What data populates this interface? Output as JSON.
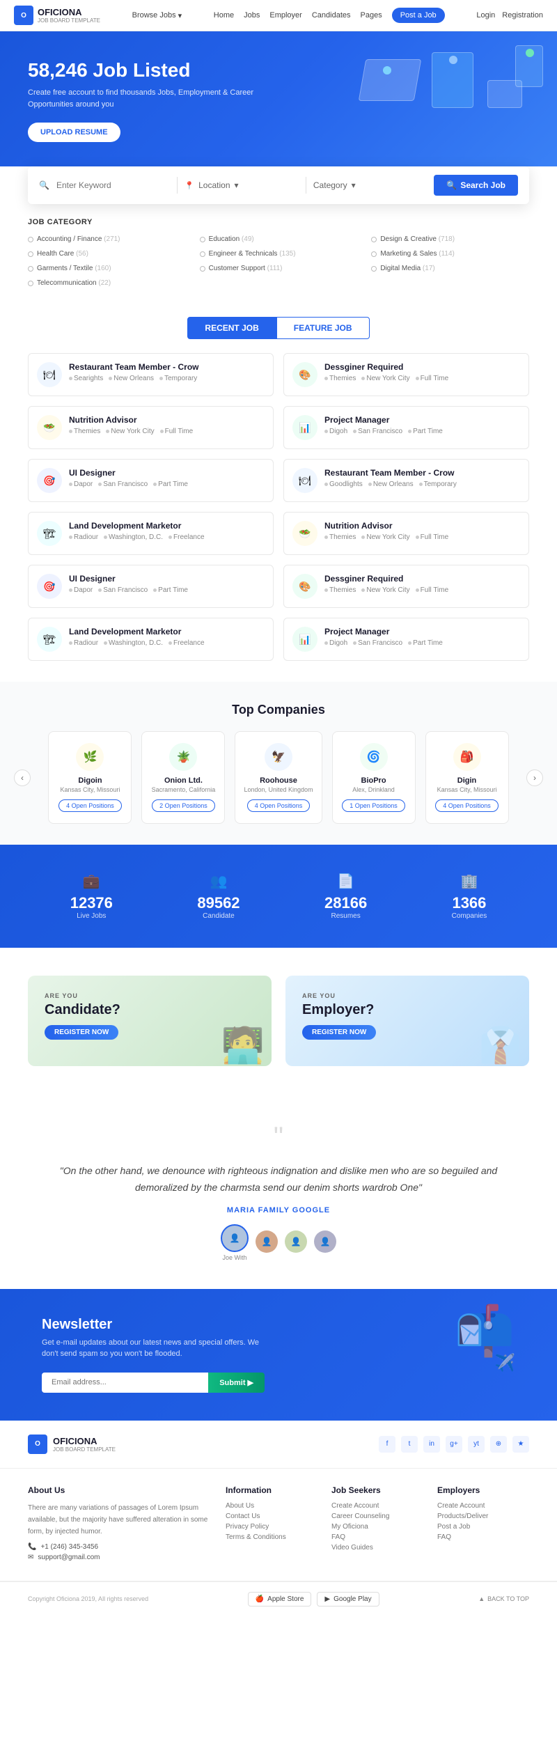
{
  "brand": {
    "name": "OFICIONA",
    "tagline": "JOB BOARD TEMPLATE",
    "logo_letter": "O"
  },
  "navbar": {
    "browse_label": "Browse Jobs",
    "links": [
      "Home",
      "Jobs",
      "Employer",
      "Candidates",
      "Pages"
    ],
    "post_job_label": "Post a Job",
    "login_label": "Login",
    "register_label": "Registration"
  },
  "hero": {
    "title": "58,246 Job Listed",
    "subtitle": "Create free account to find thousands Jobs, Employment & Career Opportunities around you",
    "cta_label": "UPLOAD RESUME"
  },
  "search": {
    "keyword_placeholder": "Enter Keyword",
    "location_label": "Location",
    "category_label": "Category",
    "button_label": "Search Job"
  },
  "job_category": {
    "title": "JOB CATEGORY",
    "categories": [
      {
        "name": "Accounting / Finance",
        "count": "(271)"
      },
      {
        "name": "Education",
        "count": "(49)"
      },
      {
        "name": "Design & Creative",
        "count": "(718)"
      },
      {
        "name": "Health Care",
        "count": "(56)"
      },
      {
        "name": "Engineer & Technicals",
        "count": "(135)"
      },
      {
        "name": "Marketing & Sales",
        "count": "(114)"
      },
      {
        "name": "Garments / Textile",
        "count": "(160)"
      },
      {
        "name": "Customer Support",
        "count": "(111)"
      },
      {
        "name": "Digital Media",
        "count": "(17)"
      },
      {
        "name": "Telecommunication",
        "count": "(22)"
      }
    ]
  },
  "tabs": [
    {
      "label": "RECENT JOB",
      "active": true
    },
    {
      "label": "FEATURE JOB",
      "active": false
    }
  ],
  "jobs": [
    {
      "title": "Restaurant Team Member - Crow",
      "company": "Searights",
      "location": "New Orleans",
      "type": "Temporary",
      "icon_color": "#3b82f6",
      "icon_bg": "#eff6ff",
      "icon": "🍽"
    },
    {
      "title": "Dessginer Required",
      "company": "Themies",
      "location": "New York City",
      "type": "Full Time",
      "icon_color": "#10b981",
      "icon_bg": "#ecfdf5",
      "icon": "🎨"
    },
    {
      "title": "Nutrition Advisor",
      "company": "Themies",
      "location": "New York City",
      "type": "Full Time",
      "icon_color": "#f59e0b",
      "icon_bg": "#fffbeb",
      "icon": "🥗"
    },
    {
      "title": "Project Manager",
      "company": "Digoh",
      "location": "San Francisco",
      "type": "Part Time",
      "icon_color": "#10b981",
      "icon_bg": "#ecfdf5",
      "icon": "📊"
    },
    {
      "title": "UI Designer",
      "company": "Dapor",
      "location": "San Francisco",
      "type": "Part Time",
      "icon_color": "#6366f1",
      "icon_bg": "#eef2ff",
      "icon": "🎯"
    },
    {
      "title": "Restaurant Team Member - Crow",
      "company": "Goodlights",
      "location": "New Orleans",
      "type": "Temporary",
      "icon_color": "#3b82f6",
      "icon_bg": "#eff6ff",
      "icon": "🍽"
    },
    {
      "title": "Land Development Marketor",
      "company": "Radiour",
      "location": "Washington, D.C.",
      "type": "Freelance",
      "icon_color": "#06b6d4",
      "icon_bg": "#ecfeff",
      "icon": "🏗"
    },
    {
      "title": "Nutrition Advisor",
      "company": "Themies",
      "location": "New York City",
      "type": "Full Time",
      "icon_color": "#f59e0b",
      "icon_bg": "#fffbeb",
      "icon": "🥗"
    },
    {
      "title": "UI Designer",
      "company": "Dapor",
      "location": "San Francisco",
      "type": "Part Time",
      "icon_color": "#6366f1",
      "icon_bg": "#eef2ff",
      "icon": "🎯"
    },
    {
      "title": "Dessginer Required",
      "company": "Themies",
      "location": "New York City",
      "type": "Full Time",
      "icon_color": "#10b981",
      "icon_bg": "#ecfdf5",
      "icon": "🎨"
    },
    {
      "title": "Land Development Marketor",
      "company": "Radiour",
      "location": "Washington, D.C.",
      "type": "Freelance",
      "icon_color": "#06b6d4",
      "icon_bg": "#ecfeff",
      "icon": "🏗"
    },
    {
      "title": "Project Manager",
      "company": "Digoh",
      "location": "San Francisco",
      "type": "Part Time",
      "icon_color": "#10b981",
      "icon_bg": "#ecfdf5",
      "icon": "📊"
    }
  ],
  "companies_section": {
    "title": "Top Companies",
    "companies": [
      {
        "name": "Digoin",
        "location": "Kansas City, Missouri",
        "positions": "4 Open Positions",
        "icon": "🌿",
        "icon_bg": "#fffbeb"
      },
      {
        "name": "Onion Ltd.",
        "location": "Sacramento, California",
        "positions": "2 Open Positions",
        "icon": "🪴",
        "icon_bg": "#ecfdf5"
      },
      {
        "name": "Roohouse",
        "location": "London, United Kingdom",
        "positions": "4 Open Positions",
        "icon": "🦅",
        "icon_bg": "#eff6ff"
      },
      {
        "name": "BioPro",
        "location": "Alex, Drinkland",
        "positions": "1 Open Positions",
        "icon": "🌀",
        "icon_bg": "#f0fdf4"
      },
      {
        "name": "Digin",
        "location": "Kansas City, Missouri",
        "positions": "4 Open Positions",
        "icon": "🎒",
        "icon_bg": "#fffbeb"
      }
    ]
  },
  "stats": [
    {
      "icon": "💼",
      "number": "12376",
      "label": "Live Jobs"
    },
    {
      "icon": "👥",
      "number": "89562",
      "label": "Candidate"
    },
    {
      "icon": "📄",
      "number": "28166",
      "label": "Resumes"
    },
    {
      "icon": "🏢",
      "number": "1366",
      "label": "Companies"
    }
  ],
  "cta": {
    "candidate": {
      "are_you": "ARE YOU",
      "title": "Candidate?",
      "btn_label": "REGISTER NOW"
    },
    "employer": {
      "are_you": "ARE YOU",
      "title": "Employer?",
      "btn_label": "REGISTER NOW"
    }
  },
  "testimonial": {
    "quote": "\"On the other hand, we denounce with righteous indignation and dislike men who are so beguiled and demoralized by the charmsta send our denim shorts wardrob One\"",
    "author": "MARIA FAMILY GOOGLE",
    "avatars": [
      {
        "label": "Joe With"
      },
      {
        "label": ""
      },
      {
        "label": ""
      },
      {
        "label": ""
      }
    ]
  },
  "newsletter": {
    "title": "Newsletter",
    "subtitle": "Get e-mail updates about our latest news and special offers. We don't send spam so you won't be flooded.",
    "input_placeholder": "Email address...",
    "btn_label": "Submit ▶"
  },
  "footer_social": [
    "f",
    "t",
    "in",
    "g+",
    "yt",
    "rss",
    "★"
  ],
  "footer_columns": {
    "about": {
      "title": "About Us",
      "text": "There are many variations of passages of Lorem Ipsum available, but the majority have suffered alteration in some form, by injected humor.",
      "phone": "+1 (246) 345-3456",
      "email": "support@gmail.com"
    },
    "information": {
      "title": "Information",
      "links": [
        "About Us",
        "Contact Us",
        "Privacy Policy",
        "Terms & Conditions"
      ]
    },
    "job_seekers": {
      "title": "Job Seekers",
      "links": [
        "Create Account",
        "Career Counseling",
        "My Oficiona",
        "FAQ",
        "Video Guides"
      ]
    },
    "employers": {
      "title": "Employers",
      "links": [
        "Create Account",
        "Products/Deliver",
        "Post a Job",
        "FAQ"
      ]
    }
  },
  "footer_bottom": {
    "copyright": "Copyright Oficiona 2019, All rights reserved",
    "app_store_label": "Apple Store",
    "google_play_label": "Google Play",
    "back_to_top": "BACK TO TOP"
  }
}
